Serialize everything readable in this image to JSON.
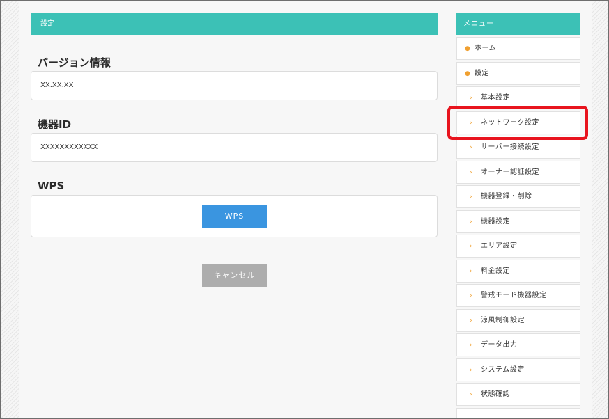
{
  "main": {
    "header": "設定",
    "version_label": "バージョン情報",
    "version_value": "XX.XX.XX",
    "device_id_label": "機器ID",
    "device_id_value": "XXXXXXXXXXXX",
    "wps_label": "WPS",
    "wps_button": "WPS",
    "cancel_button": "キャンセル"
  },
  "sidebar": {
    "header": "メニュー",
    "items": [
      {
        "label": "ホーム",
        "level": "top"
      },
      {
        "label": "設定",
        "level": "top"
      },
      {
        "label": "基本設定",
        "level": "sub"
      },
      {
        "label": "ネットワーク設定",
        "level": "sub",
        "highlighted": true
      },
      {
        "label": "サーバー接続設定",
        "level": "sub"
      },
      {
        "label": "オーナー認証設定",
        "level": "sub"
      },
      {
        "label": "機器登録・削除",
        "level": "sub"
      },
      {
        "label": "機器設定",
        "level": "sub"
      },
      {
        "label": "エリア設定",
        "level": "sub"
      },
      {
        "label": "料金設定",
        "level": "sub"
      },
      {
        "label": "警戒モード機器設定",
        "level": "sub"
      },
      {
        "label": "涼風制御設定",
        "level": "sub"
      },
      {
        "label": "データ出力",
        "level": "sub"
      },
      {
        "label": "システム設定",
        "level": "sub"
      },
      {
        "label": "状態確認",
        "level": "sub"
      }
    ]
  },
  "colors": {
    "accent_teal": "#3cc1b6",
    "wps_blue": "#3a95e0",
    "cancel_gray": "#adadad",
    "bullet_orange": "#f0a030",
    "highlight_red": "#e8141e"
  }
}
